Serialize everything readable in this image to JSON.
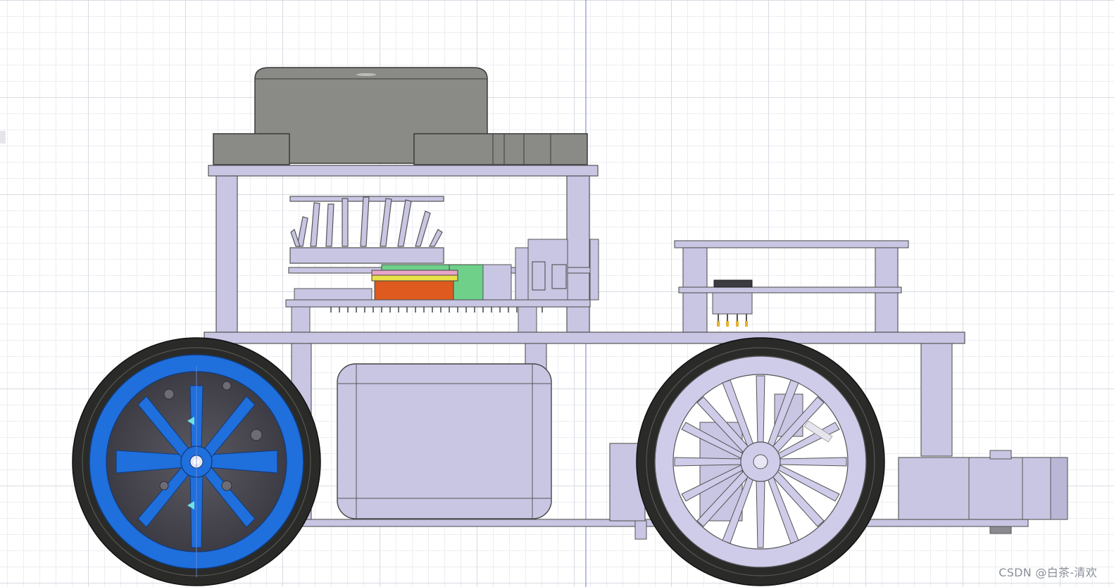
{
  "viewport": {
    "background": "#ffffff",
    "grid_major_color": "#d7dbe2",
    "grid_minor_color": "#eceef2",
    "axis_color": "#8c8fd0"
  },
  "model": {
    "description": "robot-car-side-view",
    "plate_color": "#c9c6e4",
    "lidar_color": "#8a8a86",
    "front_wheel_hub_color": "#1f6fdc",
    "rear_wheel_hub_color": "#cfccea",
    "tire_color": "#2a2b29",
    "board_green": "#6fd08a",
    "board_orange": "#de5a1f",
    "board_yellow": "#e9e04a",
    "board_pink": "#e9a5c9"
  },
  "watermark": {
    "text": "CSDN @白茶-清欢"
  }
}
